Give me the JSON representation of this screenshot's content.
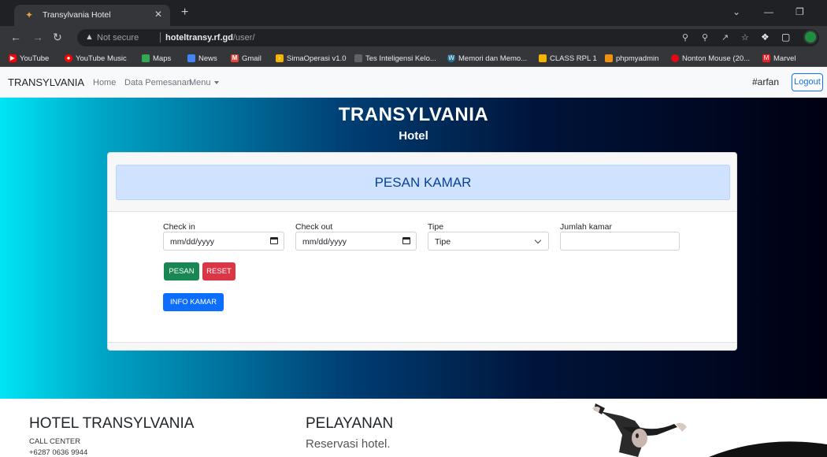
{
  "browser": {
    "tab_title": "Transylvania Hotel",
    "omnibox": {
      "security_label": "Not secure",
      "url_domain": "hoteltransy.rf.gd",
      "url_path": "/user/"
    },
    "bookmarks": [
      {
        "label": "YouTube",
        "icon": "youtube-icon",
        "color": "#ff0000"
      },
      {
        "label": "YouTube Music",
        "icon": "youtube-music-icon",
        "color": "#ff0000"
      },
      {
        "label": "Maps",
        "icon": "maps-icon",
        "color": "#34a853"
      },
      {
        "label": "News",
        "icon": "news-icon",
        "color": "#4285f4"
      },
      {
        "label": "Gmail",
        "icon": "gmail-icon",
        "color": "#ea4335"
      },
      {
        "label": "SimaOperasi v1.0",
        "icon": "arrow-icon",
        "color": "#f4b400"
      },
      {
        "label": "Tes Inteligensi Kelo...",
        "icon": "page-icon",
        "color": "#5f6368"
      },
      {
        "label": "Memori dan Memo...",
        "icon": "wordpress-icon",
        "color": "#21759b"
      },
      {
        "label": "CLASS RPL 1",
        "icon": "classroom-icon",
        "color": "#f4b400"
      },
      {
        "label": "phpmyadmin",
        "icon": "phpmyadmin-icon",
        "color": "#f29111"
      },
      {
        "label": "Nonton Mouse (20...",
        "icon": "video-icon",
        "color": "#e50914"
      },
      {
        "label": "Marvel",
        "icon": "marvel-icon",
        "color": "#ec1d24"
      }
    ]
  },
  "navbar": {
    "brand": "TRANSYLVANIA",
    "links": [
      "Home",
      "Data Pemesanan",
      "Menu"
    ],
    "username": "#arfan",
    "logout_label": "Logout"
  },
  "hero": {
    "title": "TRANSYLVANIA",
    "subtitle": "Hotel"
  },
  "booking": {
    "heading": "PESAN KAMAR",
    "check_in": {
      "label": "Check in",
      "placeholder": "mm/dd/yyyy"
    },
    "check_out": {
      "label": "Check out",
      "placeholder": "mm/dd/yyyy"
    },
    "type": {
      "label": "Tipe",
      "selected": "Tipe"
    },
    "rooms": {
      "label": "Jumlah kamar",
      "value": ""
    },
    "submit_label": "PESAN",
    "reset_label": "RESET",
    "info_label": "INFO KAMAR"
  },
  "footer": {
    "hotel_title": "HOTEL TRANSYLVANIA",
    "call_center_label": "CALL CENTER",
    "phone": "+6287 0636 9944",
    "service_title": "PELAYANAN",
    "service_item": "Reservasi hotel."
  },
  "colors": {
    "primary": "#0d6efd",
    "success": "#198754",
    "danger": "#dc3545",
    "alert_bg": "#cfe2ff",
    "alert_text": "#084298"
  }
}
